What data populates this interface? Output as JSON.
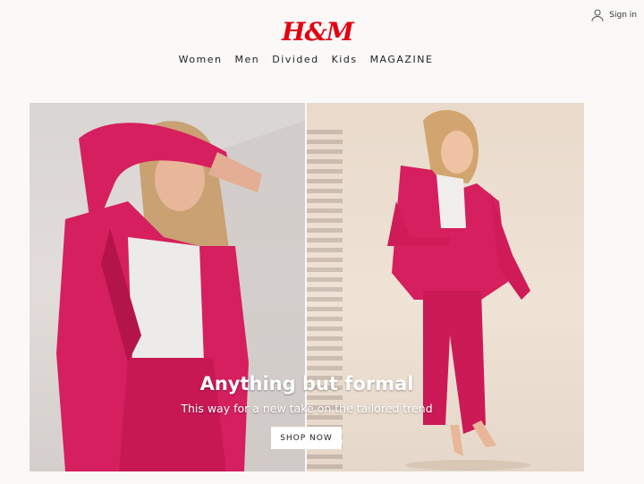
{
  "brand": {
    "logo_text": "H&M",
    "color": "#e50010"
  },
  "account": {
    "signin_label": "Sign in",
    "icon": "user-icon"
  },
  "nav": {
    "items": [
      {
        "label": "Women"
      },
      {
        "label": "Men"
      },
      {
        "label": "Divided"
      },
      {
        "label": "Kids"
      },
      {
        "label": "MAGAZINE"
      }
    ]
  },
  "hero": {
    "headline": "Anything but formal",
    "subline": "This way for a new take on the tailored trend",
    "cta_label": "SHOP NOW",
    "accent_color": "#d61f5e"
  }
}
